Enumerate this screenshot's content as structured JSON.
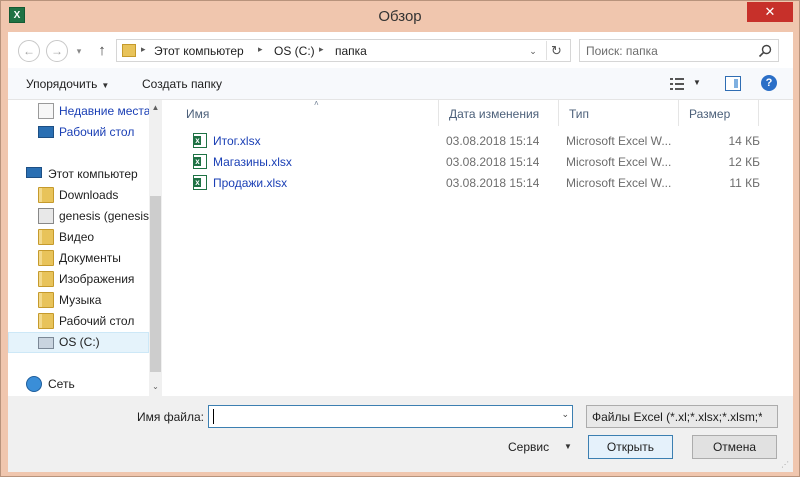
{
  "window": {
    "title": "Обзор",
    "app_icon_text": "X",
    "close_glyph": "✕"
  },
  "address_bar": {
    "back_glyph": "←",
    "forward_glyph": "→",
    "history_glyph": "▾",
    "up_glyph": "↑",
    "crumbs": [
      "Этот компьютер",
      "OS (C:)",
      "папка"
    ],
    "separator_glyph": "▸",
    "dropdown_glyph": "⌄",
    "refresh_glyph": "↻"
  },
  "search": {
    "placeholder": "Поиск: папка"
  },
  "toolbar": {
    "organize_label": "Упорядочить",
    "new_folder_label": "Создать папку",
    "dropdown_glyph": "▼",
    "help_glyph": "?"
  },
  "sidebar": {
    "items": [
      {
        "label": "Недавние места",
        "icon": "recent-places-icon",
        "blue": true
      },
      {
        "label": "Рабочий стол",
        "icon": "desktop-icon",
        "blue": true
      },
      {
        "label": "Этот компьютер",
        "icon": "computer-icon",
        "blue": false
      },
      {
        "label": "Downloads",
        "icon": "folder-icon",
        "blue": false
      },
      {
        "label": "genesis (genesist",
        "icon": "user-folder-icon",
        "blue": false
      },
      {
        "label": "Видео",
        "icon": "folder-icon",
        "blue": false
      },
      {
        "label": "Документы",
        "icon": "folder-icon",
        "blue": false
      },
      {
        "label": "Изображения",
        "icon": "folder-icon",
        "blue": false
      },
      {
        "label": "Музыка",
        "icon": "folder-icon",
        "blue": false
      },
      {
        "label": "Рабочий стол",
        "icon": "folder-icon",
        "blue": false
      },
      {
        "label": "OS (C:)",
        "icon": "drive-icon",
        "blue": false
      },
      {
        "label": "Сеть",
        "icon": "network-icon",
        "blue": false
      }
    ],
    "selected": "OS (C:)",
    "scroll_up_glyph": "▲",
    "scroll_down_glyph": "⌄"
  },
  "filelist": {
    "columns": [
      "Имя",
      "Дата изменения",
      "Тип",
      "Размер"
    ],
    "sort_glyph": "˄",
    "rows": [
      {
        "name": "Итог.xlsx",
        "date": "03.08.2018 15:14",
        "type": "Microsoft Excel W...",
        "size": "14 КБ"
      },
      {
        "name": "Магазины.xlsx",
        "date": "03.08.2018 15:14",
        "type": "Microsoft Excel W...",
        "size": "12 КБ"
      },
      {
        "name": "Продажи.xlsx",
        "date": "03.08.2018 15:14",
        "type": "Microsoft Excel W...",
        "size": "11 КБ"
      }
    ]
  },
  "bottom": {
    "filename_label": "Имя файла:",
    "filename_value": "",
    "filename_dropdown_glyph": "⌄",
    "filter_value": "Файлы Excel (*.xl;*.xlsx;*.xlsm;*.",
    "service_label": "Сервис",
    "service_arrow_glyph": "▼",
    "open_label": "Открыть",
    "cancel_label": "Отмена",
    "grip_glyph": "⋰"
  }
}
